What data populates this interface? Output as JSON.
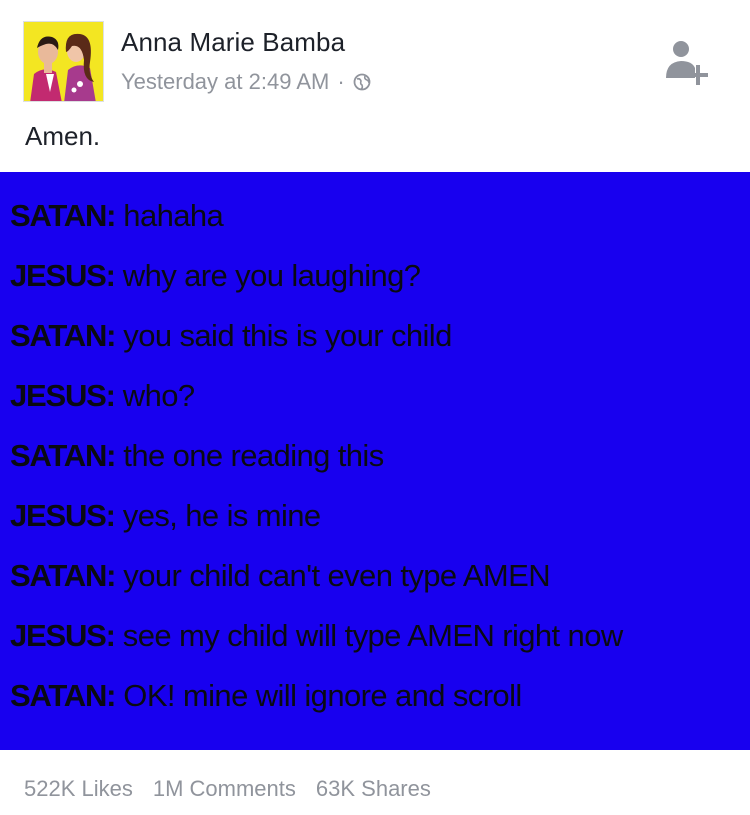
{
  "post": {
    "author": "Anna Marie Bamba",
    "timestamp": "Yesterday at 2:49 AM",
    "separator": "·",
    "privacy_icon": "globe-icon",
    "caption": "Amen."
  },
  "image_text": {
    "lines": [
      {
        "speaker": "SATAN:",
        "text": " hahaha"
      },
      {
        "speaker": "JESUS:",
        "text": " why are you laughing?"
      },
      {
        "speaker": "SATAN:",
        "text": " you said this is your child"
      },
      {
        "speaker": "JESUS:",
        "text": " who?"
      },
      {
        "speaker": "SATAN:",
        "text": " the one reading this"
      },
      {
        "speaker": "JESUS:",
        "text": " yes, he is mine"
      },
      {
        "speaker": "SATAN:",
        "text": " your child can't even type AMEN"
      },
      {
        "speaker": "JESUS:",
        "text": " see my child will type AMEN right now"
      },
      {
        "speaker": "SATAN:",
        "text": " OK! mine will ignore and scroll"
      }
    ]
  },
  "stats": {
    "likes": "522K Likes",
    "comments": "1M Comments",
    "shares": "63K Shares"
  },
  "colors": {
    "image_background": "#1800ef",
    "image_text": "#0a0a12",
    "secondary_text": "#90949c",
    "primary_text": "#1d2129"
  }
}
